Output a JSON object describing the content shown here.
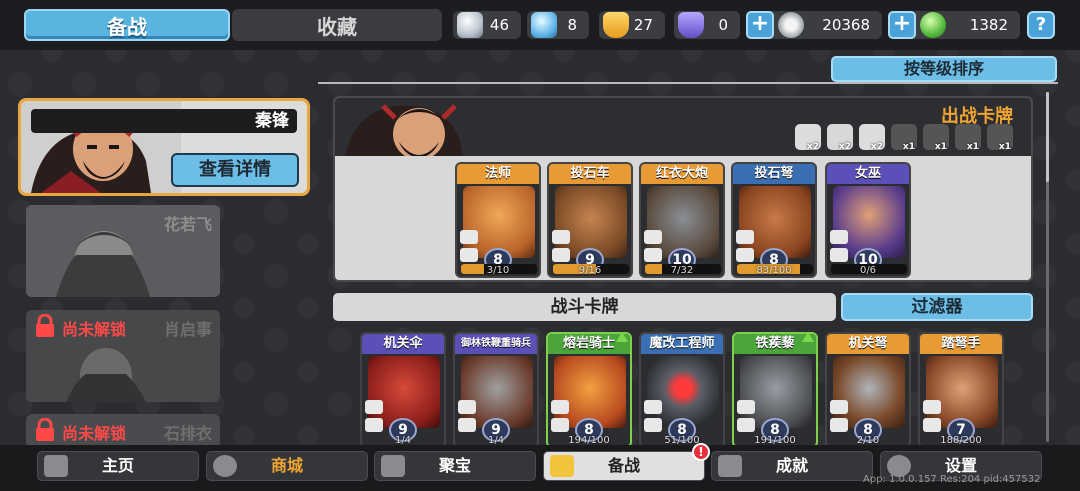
{
  "tabs": {
    "active": "备战",
    "inactive": "收藏"
  },
  "resources": [
    {
      "icon": "silver-gem-icon",
      "value": "46"
    },
    {
      "icon": "blue-crystal-icon",
      "value": "8"
    },
    {
      "icon": "gold-shield-icon",
      "value": "27"
    },
    {
      "icon": "purple-shield-icon",
      "value": "0"
    },
    {
      "icon": "silver-coin-icon",
      "value": "20368"
    },
    {
      "icon": "green-gem-icon",
      "value": "1382"
    }
  ],
  "help_label": "?",
  "sort_label": "按等级排序",
  "heroes": {
    "selected": {
      "name": "秦锋",
      "detail_label": "查看详情"
    },
    "second": {
      "name": "花若飞"
    },
    "locked1": {
      "status": "尚未解锁",
      "name": "肖启事"
    },
    "locked2": {
      "status": "尚未解锁",
      "name": "石排衣"
    }
  },
  "deck": {
    "title": "出战卡牌",
    "costs": [
      {
        "icon": "skull-icon",
        "count": "x2"
      },
      {
        "icon": "brick-icon",
        "count": "x2"
      },
      {
        "icon": "explosion-icon",
        "count": "x2"
      },
      {
        "icon": "helmet-icon",
        "count": "x1"
      },
      {
        "icon": "gear-icon",
        "count": "x1"
      },
      {
        "icon": "feather-icon",
        "count": "x1"
      },
      {
        "icon": "shield-icon",
        "count": "x1"
      }
    ],
    "cards": [
      {
        "name": "法师",
        "level": "8",
        "progress": "3/10",
        "ratio": 0.3
      },
      {
        "name": "投石车",
        "level": "9",
        "progress": "9/16",
        "ratio": 0.56
      },
      {
        "name": "红衣大炮",
        "level": "10",
        "progress": "7/32",
        "ratio": 0.22
      },
      {
        "name": "投石弩",
        "level": "8",
        "progress": "83/100",
        "ratio": 0.83
      },
      {
        "name": "女巫",
        "level": "10",
        "progress": "0/6",
        "ratio": 0.0
      }
    ]
  },
  "battle_cards_label": "战斗卡牌",
  "filter_label": "过滤器",
  "battle_cards": [
    {
      "name": "机关伞",
      "level": "9",
      "progress": "1/4"
    },
    {
      "name": "御林铁鞭重骑兵",
      "level": "9",
      "progress": "1/4"
    },
    {
      "name": "熔岩骑士",
      "level": "8",
      "progress": "194/100"
    },
    {
      "name": "魔改工程师",
      "level": "8",
      "progress": "51/100"
    },
    {
      "name": "铁蒺藜",
      "level": "8",
      "progress": "191/100"
    },
    {
      "name": "机关弩",
      "level": "8",
      "progress": "2/10"
    },
    {
      "name": "踏弩手",
      "level": "7",
      "progress": "188/200"
    }
  ],
  "nav": [
    {
      "label": "主页",
      "icon": "home-icon"
    },
    {
      "label": "商城",
      "icon": "coins-icon"
    },
    {
      "label": "聚宝",
      "icon": "treasure-icon"
    },
    {
      "label": "备战",
      "icon": "cards-icon"
    },
    {
      "label": "成就",
      "icon": "achievement-icon"
    },
    {
      "label": "设置",
      "icon": "gear-icon"
    }
  ],
  "nav_badge": "!",
  "app_info": "App: 1.0.0.157 Res:204 pid:457532"
}
